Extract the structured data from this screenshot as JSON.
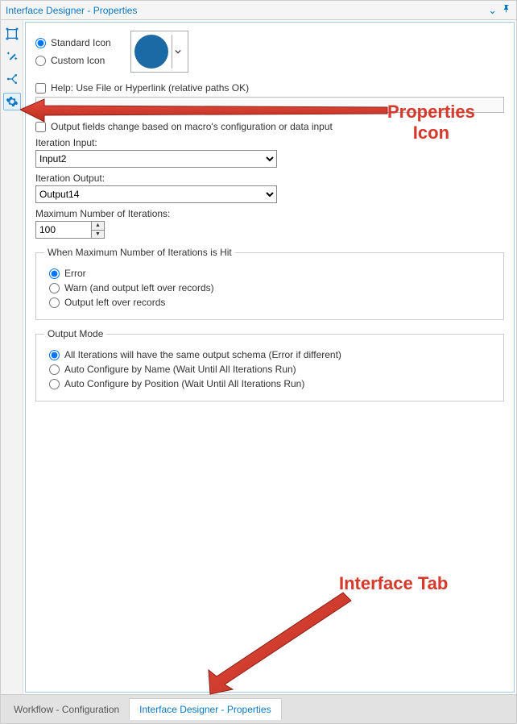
{
  "titlebar": {
    "title": "Interface Designer - Properties"
  },
  "icon_type": {
    "standard_label": "Standard Icon",
    "custom_label": "Custom Icon",
    "selected": "standard",
    "swatch_color": "#1b6aa5"
  },
  "help": {
    "label": "Help: Use File or Hyperlink (relative paths OK)",
    "checked": false
  },
  "output_fields_change": {
    "label": "Output fields change based on macro's configuration or data input",
    "checked": false
  },
  "iteration_input": {
    "label": "Iteration Input:",
    "value": "Input2"
  },
  "iteration_output": {
    "label": "Iteration Output:",
    "value": "Output14"
  },
  "max_iterations": {
    "label": "Maximum Number of Iterations:",
    "value": "100"
  },
  "max_hit_group": {
    "legend": "When Maximum Number of Iterations is Hit",
    "options": [
      "Error",
      "Warn (and output left over records)",
      "Output left over records"
    ],
    "selected": 0
  },
  "output_mode_group": {
    "legend": "Output Mode",
    "options": [
      "All Iterations will have the same output schema (Error if different)",
      "Auto Configure by Name (Wait Until All Iterations Run)",
      "Auto Configure by Position (Wait Until All Iterations Run)"
    ],
    "selected": 0
  },
  "bottom_tabs": {
    "tabs": [
      {
        "label": "Workflow - Configuration",
        "active": false
      },
      {
        "label": "Interface Designer - Properties",
        "active": true
      }
    ]
  },
  "annotations": {
    "properties_icon": "Properties\nIcon",
    "interface_tab": "Interface Tab"
  },
  "colors": {
    "accent": "#0b77c2",
    "annotation": "#d53a2c"
  }
}
